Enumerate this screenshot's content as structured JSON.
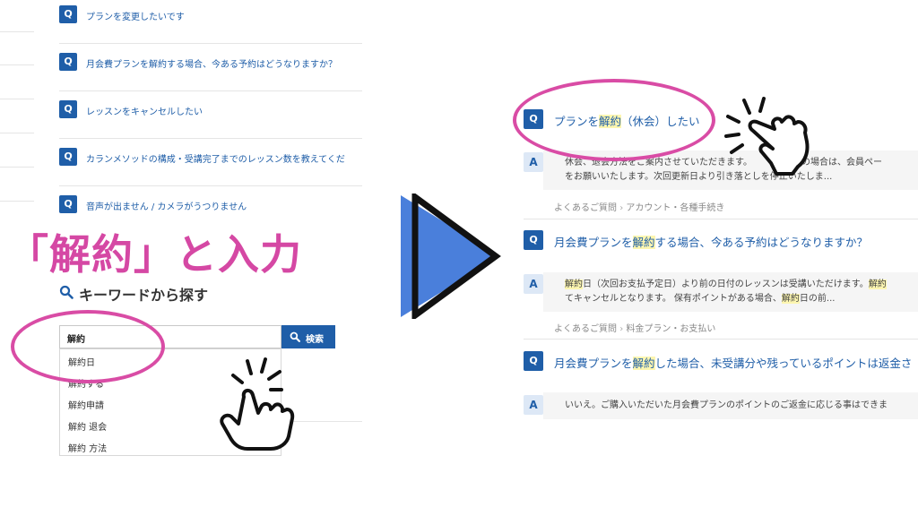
{
  "left_panel": {
    "faq_items": [
      {
        "badge": "Q",
        "text": "プランを変更したいです"
      },
      {
        "badge": "Q",
        "text": "月会費プランを解約する場合、今ある予約はどうなりますか？"
      },
      {
        "badge": "Q",
        "text": "レッスンをキャンセルしたい"
      },
      {
        "badge": "Q",
        "text": "カランメソッドの構成・受講完了までのレッスン数を教えてくだ"
      },
      {
        "badge": "Q",
        "text": "音声が出ません / カメラがうつりません"
      }
    ],
    "instruction": "「解約」と入力",
    "keyword_title": "キーワードから探す",
    "search": {
      "value": "解約",
      "button_label": "検索"
    },
    "suggestions": [
      "解約日",
      "解約する",
      "解約申請",
      "解約 退会",
      "解約 方法"
    ]
  },
  "right_panel": {
    "results": [
      {
        "q_badge": "Q",
        "q_pre": "プランを",
        "q_hl": "解約",
        "q_post": "（休会）したい",
        "a_badge": "A",
        "a_line1": "休会、退会方法をご案内させていただきます。　　　　希望の場合は、会員ペー",
        "a_line2": "をお願いいたします。次回更新日より引き落としを停止いたしま...",
        "category_1": "よくあるご質問",
        "category_2": "アカウント・各種手続き"
      },
      {
        "q_badge": "Q",
        "q_pre": "月会費プランを",
        "q_hl": "解約",
        "q_post": "する場合、今ある予約はどうなりますか？",
        "a_badge": "A",
        "a_line1_hl": "解約",
        "a_line1_post": "日（次回お支払予定日）より前の日付のレッスンは受講いただけます。",
        "a_line1_hl2": "解約",
        "a_line2": "てキャンセルとなります。 保有ポイントがある場合、",
        "a_line2_hl": "解約",
        "a_line2_post": "日の前...",
        "category_1": "よくあるご質問",
        "category_2": "料金プラン・お支払い"
      },
      {
        "q_badge": "Q",
        "q_pre": "月会費プランを",
        "q_hl": "解約",
        "q_post": "した場合、未受講分や残っているポイントは返金さ",
        "a_badge": "A",
        "a_line1": "いいえ。ご購入いただいた月会費プランのポイントのご返金に応じる事はできま"
      }
    ]
  },
  "icons": {
    "search": "search-icon",
    "arrow": "play-arrow-icon",
    "hand": "tapping-hand-icon",
    "breadcrumb_sep": "chevron-right-icon"
  },
  "colors": {
    "brand_blue": "#1f5ea8",
    "pink": "#d548a4",
    "arrow_blue": "#4a7fdb",
    "highlight": "#fdf6b0"
  }
}
